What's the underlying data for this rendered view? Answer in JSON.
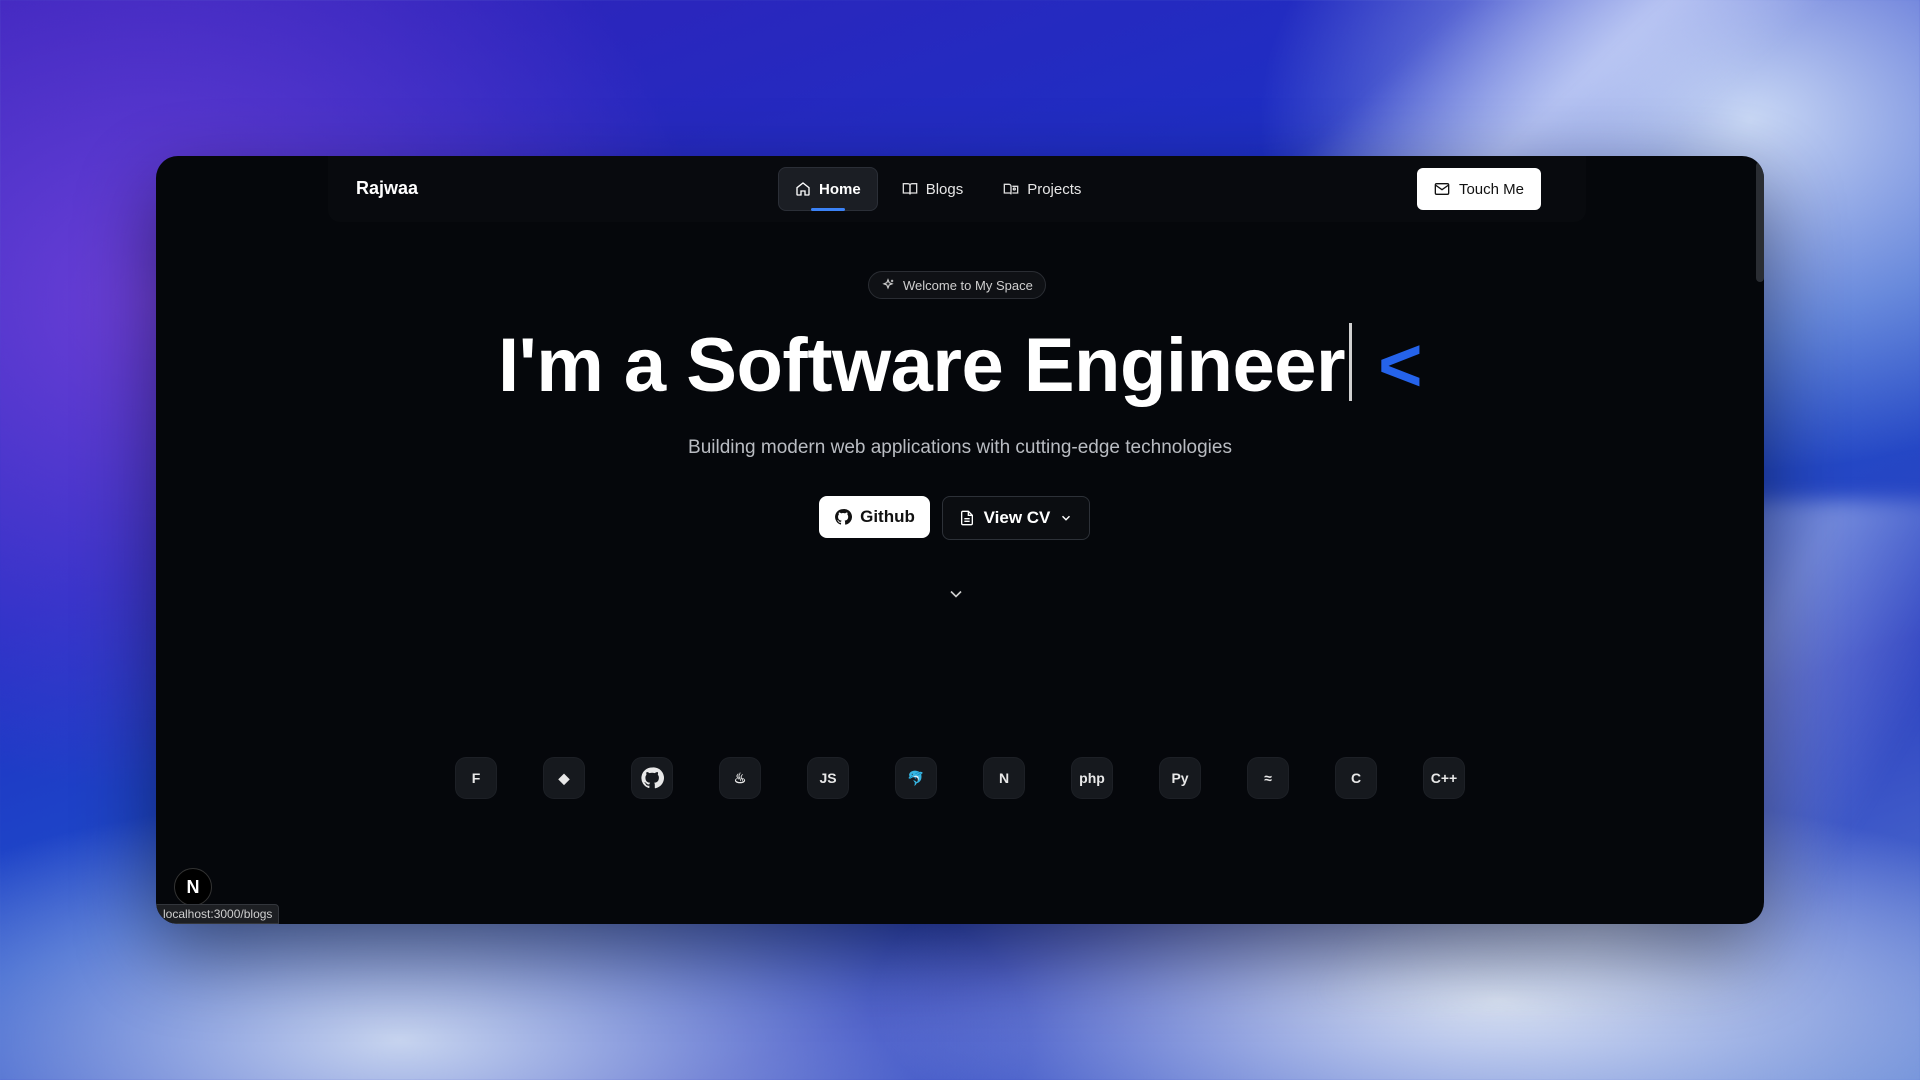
{
  "navbar": {
    "brand": "Rajwaa",
    "items": [
      {
        "label": "Home",
        "icon": "home-icon",
        "active": true
      },
      {
        "label": "Blogs",
        "icon": "book-icon",
        "active": false
      },
      {
        "label": "Projects",
        "icon": "book-open-icon",
        "active": false
      }
    ],
    "contact_button": "Touch Me"
  },
  "hero": {
    "pill": "Welcome to My Space",
    "headline": "I'm a Software Engineer",
    "headline_suffix": "<",
    "subtitle": "Building modern web applications with cutting-edge technologies",
    "github_button": "Github",
    "cv_button": "View CV"
  },
  "tech_stack": [
    {
      "name": "figma-icon",
      "glyph": "F"
    },
    {
      "name": "git-icon",
      "glyph": "◆"
    },
    {
      "name": "github-icon",
      "glyph": ""
    },
    {
      "name": "java-icon",
      "glyph": "♨"
    },
    {
      "name": "javascript-icon",
      "glyph": "JS"
    },
    {
      "name": "mysql-icon",
      "glyph": "🐬"
    },
    {
      "name": "nextjs-icon",
      "glyph": "N"
    },
    {
      "name": "php-icon",
      "glyph": "php"
    },
    {
      "name": "python-icon",
      "glyph": "Py"
    },
    {
      "name": "tailwind-icon",
      "glyph": "≈"
    },
    {
      "name": "c-icon",
      "glyph": "C"
    },
    {
      "name": "cplusplus-icon",
      "glyph": "C++"
    }
  ],
  "dev_badge": "N",
  "status_url": "localhost:3000/blogs",
  "colors": {
    "accent": "#3b82f6",
    "bracket": "#2563eb",
    "window_bg": "#05070b"
  }
}
